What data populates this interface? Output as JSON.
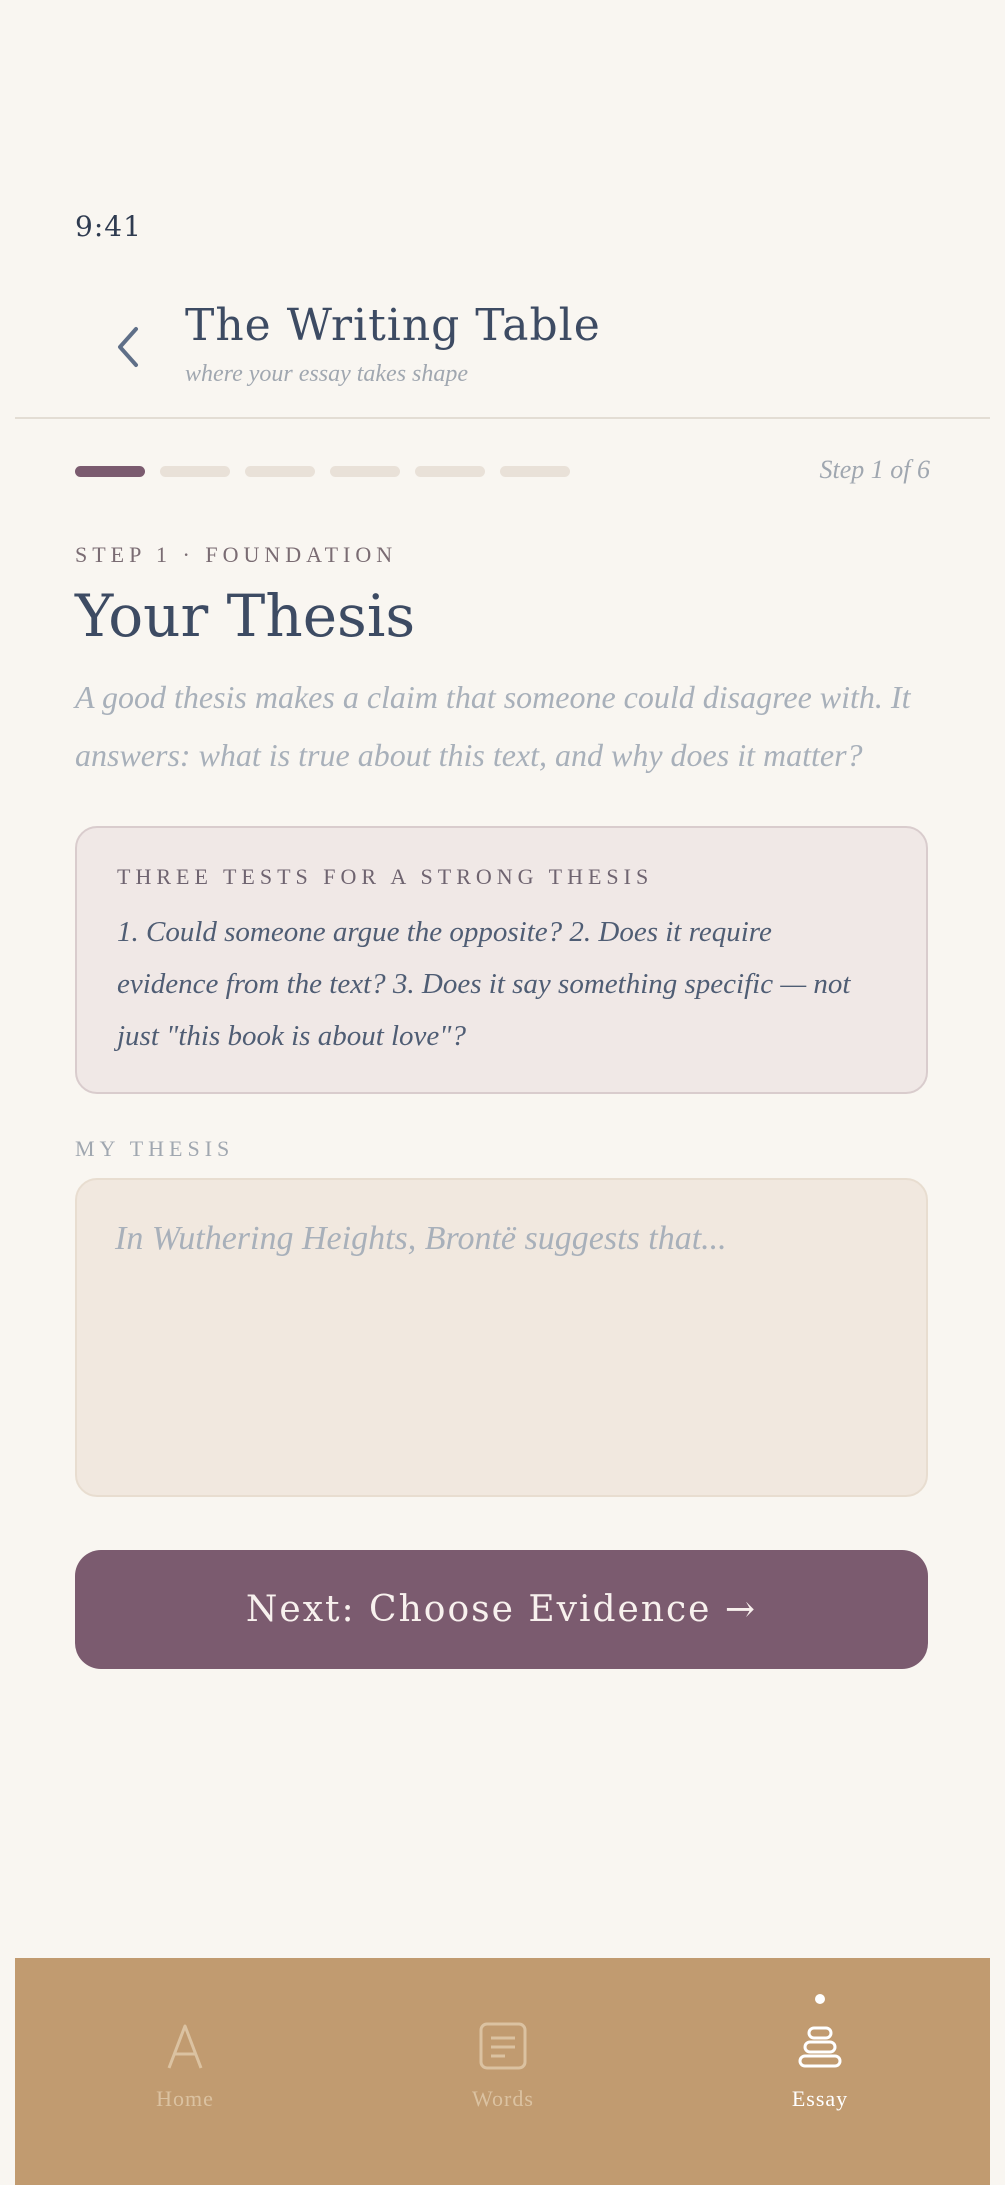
{
  "status": {
    "time": "9:41"
  },
  "header": {
    "title": "The Writing Table",
    "subtitle": "where your essay takes shape"
  },
  "progress": {
    "current_step": 1,
    "total_steps": 6,
    "label": "Step 1 of 6"
  },
  "step": {
    "eyebrow": "STEP 1 · FOUNDATION",
    "title": "Your Thesis",
    "intro": "A good thesis makes a claim that someone could disagree with. It answers: what is true about this text, and why does it matter?"
  },
  "tips": {
    "heading": "THREE TESTS FOR A STRONG THESIS",
    "body": "1. Could someone argue the opposite? 2. Does it require evidence from the text? 3. Does it say something specific — not just \"this book is about love\"?"
  },
  "thesis_field": {
    "label": "MY THESIS",
    "value": "",
    "placeholder": "In Wuthering Heights, Brontë suggests that..."
  },
  "next_button": {
    "label": "Next: Choose Evidence →"
  },
  "tabbar": {
    "items": [
      {
        "label": "Home",
        "icon": "letter-a-icon",
        "active": false
      },
      {
        "label": "Words",
        "icon": "document-icon",
        "active": false
      },
      {
        "label": "Essay",
        "icon": "stack-icon",
        "active": true
      }
    ]
  },
  "colors": {
    "background": "#f9f6f1",
    "accent": "#7b5b6f",
    "tabbar": "#c19b70",
    "title_text": "#3d4b63"
  }
}
